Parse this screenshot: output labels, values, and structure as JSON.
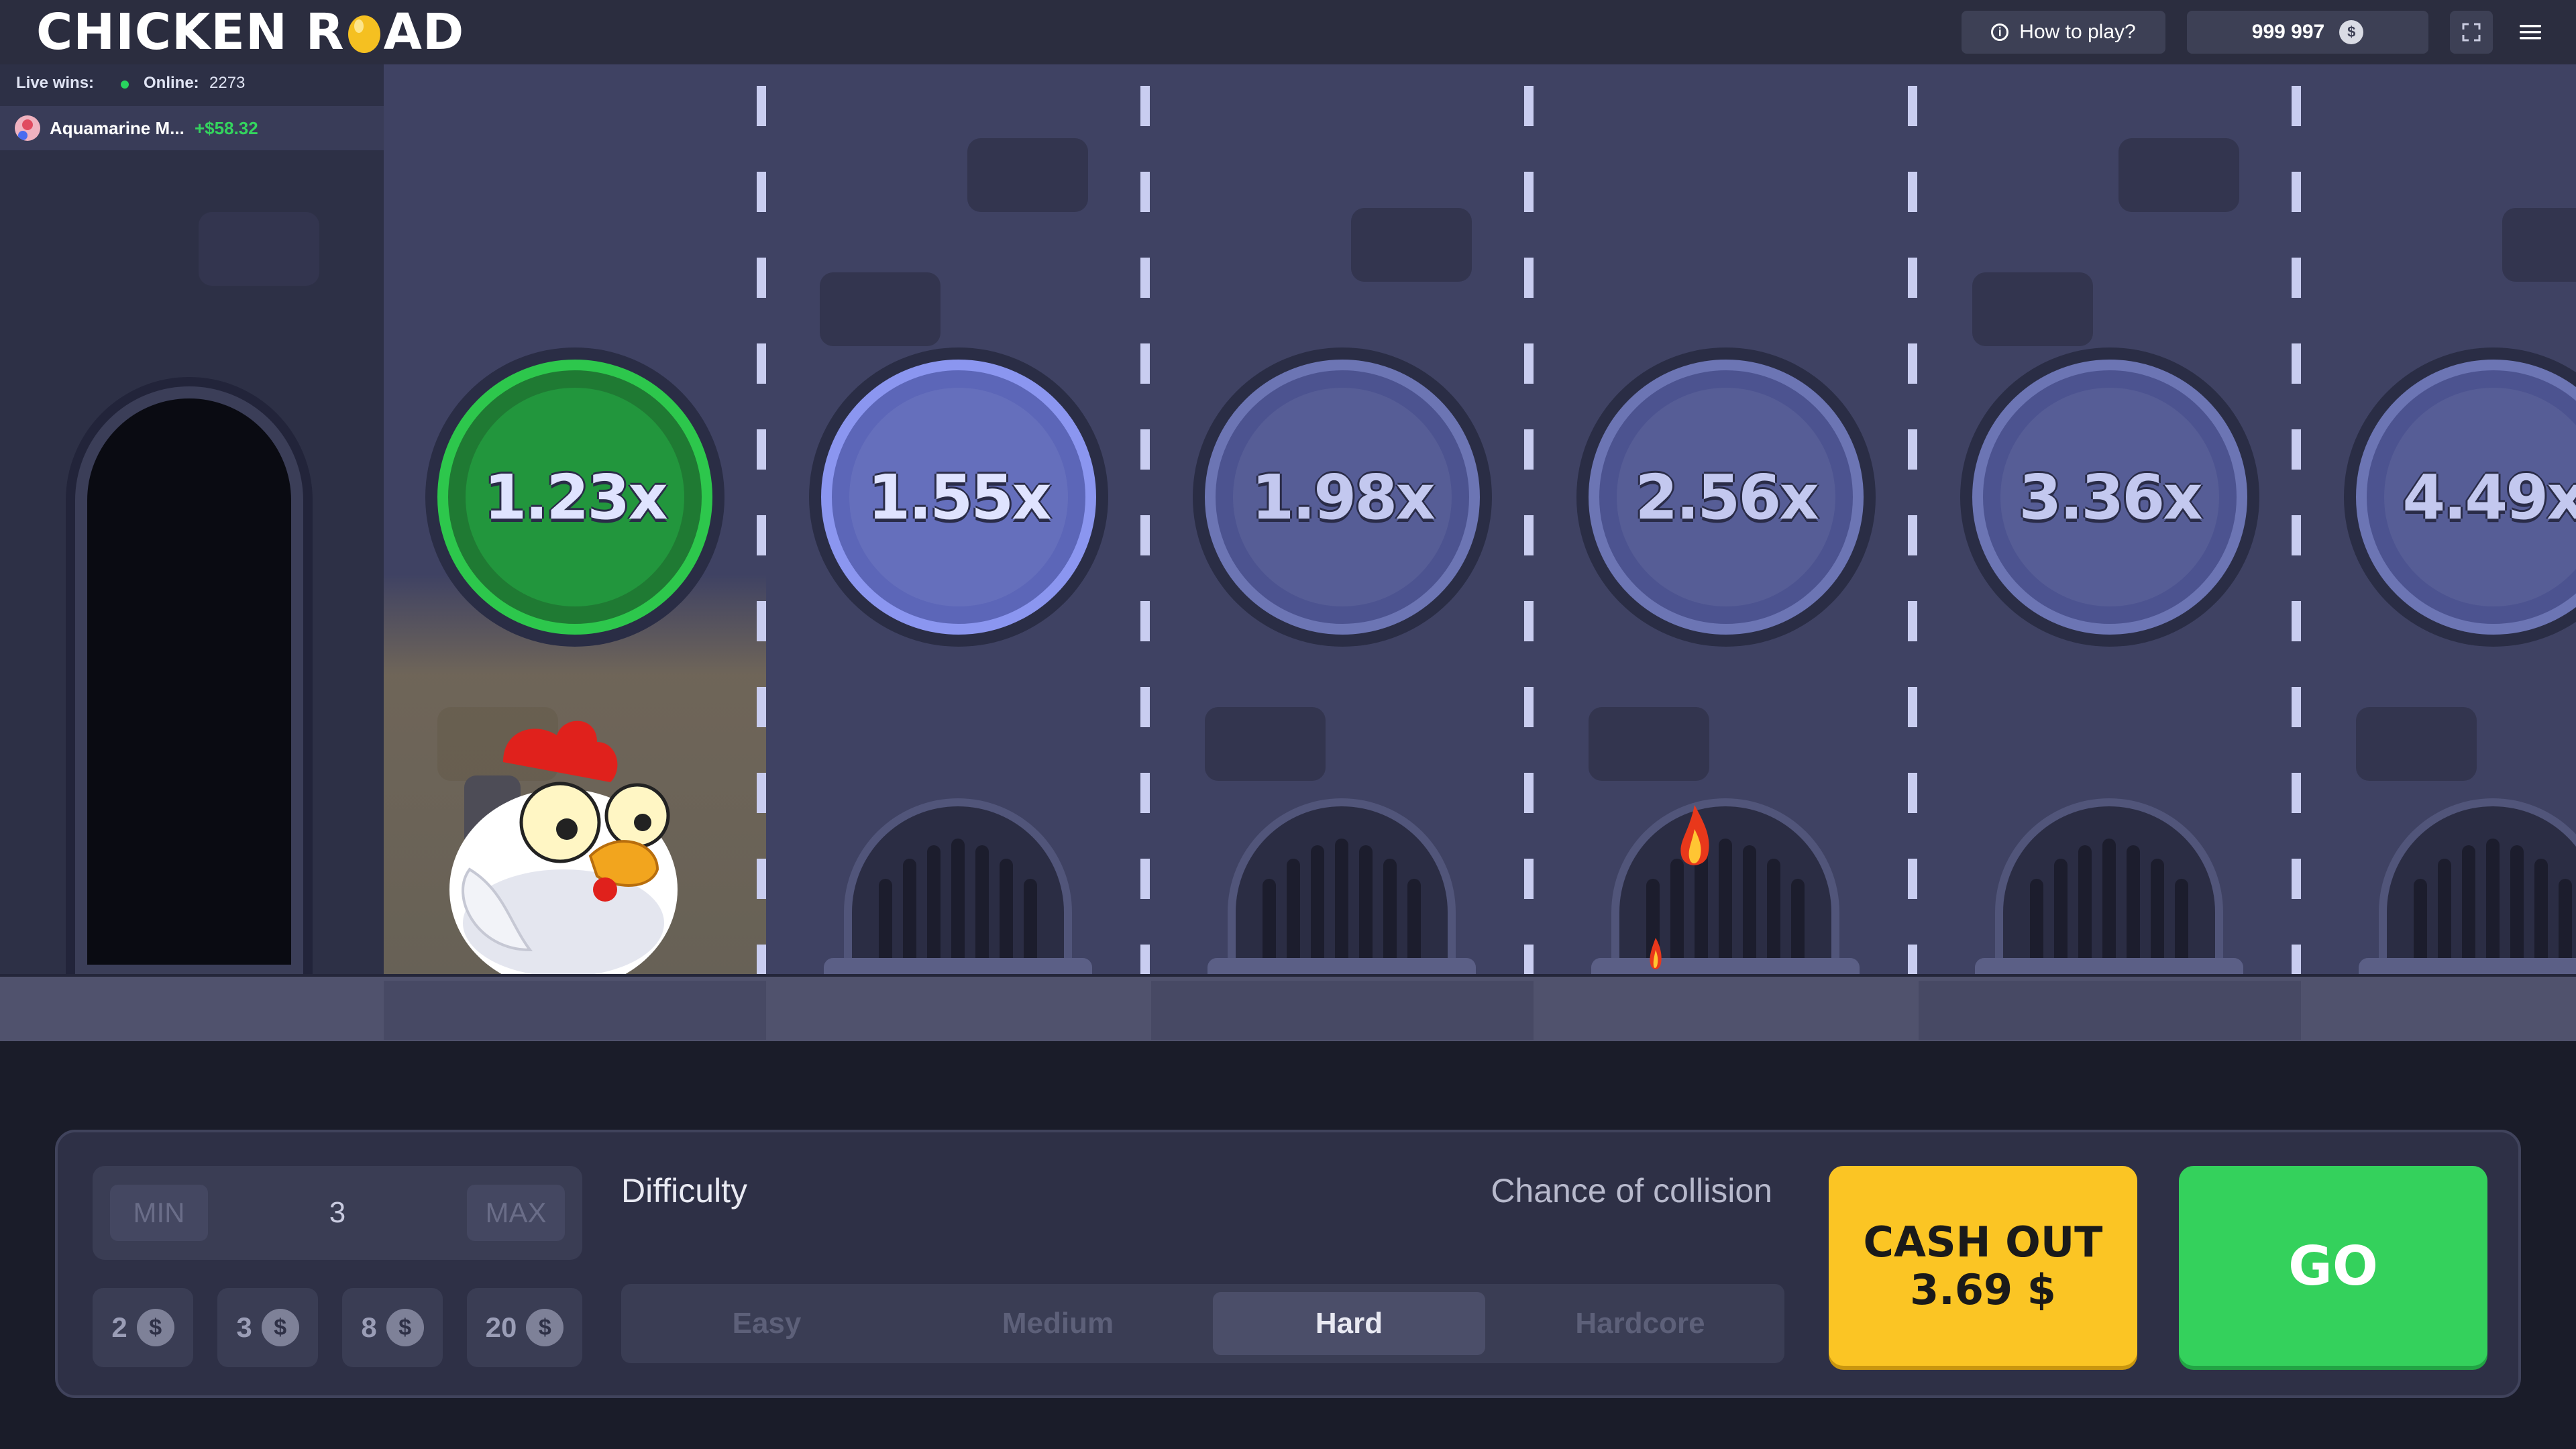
{
  "header": {
    "logo_text_1": "CHICKEN R",
    "logo_text_2": "AD",
    "how_to_play_label": "How to play?",
    "balance": "999 997",
    "currency_icon": "$"
  },
  "live": {
    "live_wins_label": "Live wins:",
    "online_label": "Online:",
    "online_count": "2273",
    "wins": [
      {
        "name": "Aquamarine M...",
        "amount": "+$58.32"
      }
    ]
  },
  "lanes": {
    "multipliers": [
      "1.23x",
      "1.55x",
      "1.98x",
      "2.56x",
      "3.36x",
      "4.49x"
    ],
    "current_index": 0
  },
  "controls": {
    "min_label": "MIN",
    "max_label": "MAX",
    "bet_value": "3",
    "quick_bets": [
      "2",
      "3",
      "8",
      "20"
    ],
    "currency": "$",
    "difficulty_label": "Difficulty",
    "chance_label": "Chance of collision",
    "difficulties": [
      "Easy",
      "Medium",
      "Hard",
      "Hardcore"
    ],
    "selected_difficulty": "Hard",
    "cashout_label": "CASH OUT",
    "cashout_amount": "3.69 $",
    "go_label": "GO"
  },
  "colors": {
    "accent_green": "#34d15c",
    "cashout_yellow": "#fbc524",
    "background": "#1a1c29",
    "road": "#3f4263"
  }
}
